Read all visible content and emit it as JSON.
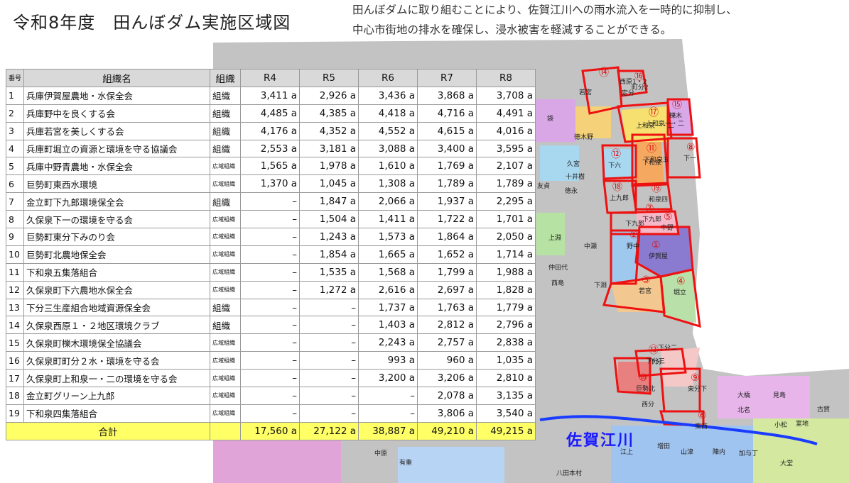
{
  "title": "令和8年度　田んぼダム実施区域図",
  "description": [
    "田んぼダムに取り組むことにより、佐賀江川への雨水流入を一時的に抑制し、",
    "中心市街地の排水を確保し、浸水被害を軽減することができる。"
  ],
  "table": {
    "headers": [
      "番号",
      "組織名",
      "組織",
      "R4",
      "R5",
      "R6",
      "R7",
      "R8"
    ],
    "rows": [
      {
        "no": "1",
        "name": "兵庫伊賀屋農地・水保全会",
        "type": "組織",
        "wide": false,
        "r4": "3,411 a",
        "r5": "2,926 a",
        "r6": "3,436 a",
        "r7": "3,868 a",
        "r8": "3,708 a"
      },
      {
        "no": "2",
        "name": "兵庫野中を良くする会",
        "type": "組織",
        "wide": false,
        "r4": "4,485 a",
        "r5": "4,385 a",
        "r6": "4,418 a",
        "r7": "4,716 a",
        "r8": "4,491 a"
      },
      {
        "no": "3",
        "name": "兵庫若宮を美しくする会",
        "type": "組織",
        "wide": false,
        "r4": "4,176 a",
        "r5": "4,352 a",
        "r6": "4,552 a",
        "r7": "4,615 a",
        "r8": "4,016 a"
      },
      {
        "no": "4",
        "name": "兵庫町堀立の資源と環境を守る協議会",
        "type": "組織",
        "wide": false,
        "r4": "2,553 a",
        "r5": "3,181 a",
        "r6": "3,088 a",
        "r7": "3,400 a",
        "r8": "3,595 a"
      },
      {
        "no": "5",
        "name": "兵庫中野青農地・水保全会",
        "type": "広域組織",
        "wide": true,
        "r4": "1,565 a",
        "r5": "1,978 a",
        "r6": "1,610 a",
        "r7": "1,769 a",
        "r8": "2,107 a"
      },
      {
        "no": "6",
        "name": "巨勢町東西水環境",
        "type": "広域組織",
        "wide": true,
        "r4": "1,370 a",
        "r5": "1,045 a",
        "r6": "1,308 a",
        "r7": "1,789 a",
        "r8": "1,789 a"
      },
      {
        "no": "7",
        "name": "金立町下九郎環境保全会",
        "type": "組織",
        "wide": false,
        "r4": "–",
        "r5": "1,847 a",
        "r6": "2,066 a",
        "r7": "1,937 a",
        "r8": "2,295 a"
      },
      {
        "no": "8",
        "name": "久保泉下一の環境を守る会",
        "type": "広域組織",
        "wide": true,
        "r4": "–",
        "r5": "1,504 a",
        "r6": "1,411 a",
        "r7": "1,722 a",
        "r8": "1,701 a"
      },
      {
        "no": "9",
        "name": "巨勢町東分下みのり会",
        "type": "広域組織",
        "wide": true,
        "r4": "–",
        "r5": "1,243 a",
        "r6": "1,573 a",
        "r7": "1,864 a",
        "r8": "2,050 a"
      },
      {
        "no": "10",
        "name": "巨勢町北農地保全会",
        "type": "広域組織",
        "wide": true,
        "r4": "–",
        "r5": "1,854 a",
        "r6": "1,665 a",
        "r7": "1,652 a",
        "r8": "1,714 a"
      },
      {
        "no": "11",
        "name": "下和泉五集落組合",
        "type": "広域組織",
        "wide": true,
        "r4": "–",
        "r5": "1,535 a",
        "r6": "1,568 a",
        "r7": "1,799 a",
        "r8": "1,988 a"
      },
      {
        "no": "12",
        "name": "久保泉町下六農地水保全会",
        "type": "広域組織",
        "wide": true,
        "r4": "–",
        "r5": "1,272 a",
        "r6": "2,616 a",
        "r7": "2,697 a",
        "r8": "1,828 a"
      },
      {
        "no": "13",
        "name": "下分三生産組合地域資源保全会",
        "type": "組織",
        "wide": false,
        "r4": "–",
        "r5": "–",
        "r6": "1,737 a",
        "r7": "1,763 a",
        "r8": "1,779 a"
      },
      {
        "no": "14",
        "name": "久保泉西原１・２地区環境クラブ",
        "type": "組織",
        "wide": false,
        "r4": "–",
        "r5": "–",
        "r6": "1,403 a",
        "r7": "2,812 a",
        "r8": "2,796 a"
      },
      {
        "no": "15",
        "name": "久保泉町櫟木環境保全協議会",
        "type": "広域組織",
        "wide": true,
        "r4": "–",
        "r5": "–",
        "r6": "2,243 a",
        "r7": "2,757 a",
        "r8": "2,838 a"
      },
      {
        "no": "16",
        "name": "久保泉町町分２水・環境を守る会",
        "type": "広域組織",
        "wide": true,
        "r4": "–",
        "r5": "–",
        "r6": "993 a",
        "r7": "960 a",
        "r8": "1,035 a"
      },
      {
        "no": "17",
        "name": "久保泉町上和泉一・二の環境を守る会",
        "type": "広域組織",
        "wide": true,
        "r4": "–",
        "r5": "–",
        "r6": "3,200 a",
        "r7": "3,206 a",
        "r8": "2,810 a"
      },
      {
        "no": "18",
        "name": "金立町グリーン上九郎",
        "type": "広域組織",
        "wide": true,
        "r4": "–",
        "r5": "–",
        "r6": "–",
        "r7": "2,078 a",
        "r8": "3,135 a"
      },
      {
        "no": "19",
        "name": "下和泉四集落組合",
        "type": "広域組織",
        "wide": true,
        "r4": "–",
        "r5": "–",
        "r6": "–",
        "r7": "3,806 a",
        "r8": "3,540 a"
      }
    ],
    "total": {
      "label": "合計",
      "r4": "17,560 a",
      "r5": "27,122 a",
      "r6": "38,887 a",
      "r7": "49,210 a",
      "r8": "49,215 a"
    }
  },
  "map": {
    "river_label": "佐賀江川",
    "area_colors": {
      "outline": "#ee1111",
      "river": "#1a3cff",
      "base": "#bdbdbd"
    },
    "area_markers": [
      {
        "n": "①",
        "name": "伊賀屋"
      },
      {
        "n": "②",
        "name": "野中"
      },
      {
        "n": "③",
        "name": "若宮"
      },
      {
        "n": "④",
        "name": "堀立"
      },
      {
        "n": "⑤",
        "name": "中野"
      },
      {
        "n": "⑥",
        "name": "東西"
      },
      {
        "n": "⑦",
        "name": "下九郎"
      },
      {
        "n": "⑧",
        "name": "下一"
      },
      {
        "n": "⑨",
        "name": "東分下"
      },
      {
        "n": "⑩",
        "name": "巨勢北"
      },
      {
        "n": "⑪",
        "name": "下和泉五"
      },
      {
        "n": "⑫",
        "name": "下六"
      },
      {
        "n": "⑬",
        "name": "下分三"
      },
      {
        "n": "⑭",
        "name": ""
      },
      {
        "n": "⑮",
        "name": "櫟木"
      },
      {
        "n": "⑯",
        "name": "町分2"
      },
      {
        "n": "⑰",
        "name": "上和泉一・二"
      },
      {
        "n": "⑱",
        "name": "上九郎"
      },
      {
        "n": "⑲",
        "name": "和泉四"
      }
    ],
    "place_labels": [
      "西原1・2",
      "定分",
      "若宮",
      "袋",
      "徳木野",
      "上和泉一・二",
      "下和泉",
      "久宮",
      "十井樹",
      "友貞",
      "徳永",
      "下分二",
      "下分",
      "江上",
      "増田",
      "山津",
      "陣内",
      "加与丁",
      "大橋",
      "見島",
      "北名",
      "小松",
      "室地",
      "古賀",
      "大堂",
      "八田本村",
      "中原",
      "有重",
      "上淵",
      "仲田代",
      "西島",
      "中瀬",
      "下淵",
      "西分",
      "下九郎"
    ]
  }
}
